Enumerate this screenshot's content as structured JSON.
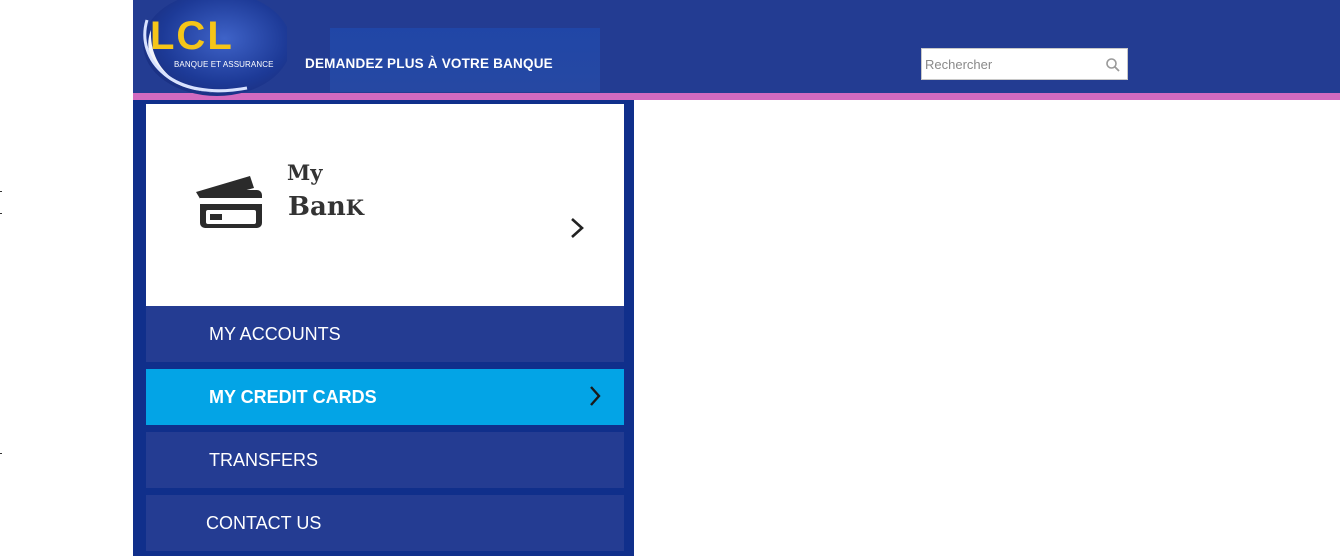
{
  "header": {
    "logo_text": "LCL",
    "logo_subtitle": "BANQUE ET ASSURANCE",
    "tagline": "DEMANDEZ PLUS À VOTRE BANQUE",
    "search_placeholder": "Rechercher",
    "search_icon": "search-icon"
  },
  "brand": {
    "line1": "My",
    "line2_main": "Ban",
    "line2_small": "K",
    "icon": "credit-card-icon"
  },
  "menu": {
    "items": [
      {
        "label": "MY ACCOUNTS",
        "active": false
      },
      {
        "label": "MY CREDIT CARDS",
        "active": true
      },
      {
        "label": "TRANSFERS",
        "active": false
      },
      {
        "label": "CONTACT US",
        "active": false
      }
    ]
  },
  "colors": {
    "header_bg": "#233c92",
    "accent_pink": "#d26ac0",
    "sidebar_border": "#102f8b",
    "menu_item": "#243c92",
    "menu_active": "#03a4e6",
    "logo_yellow": "#f5c518"
  }
}
